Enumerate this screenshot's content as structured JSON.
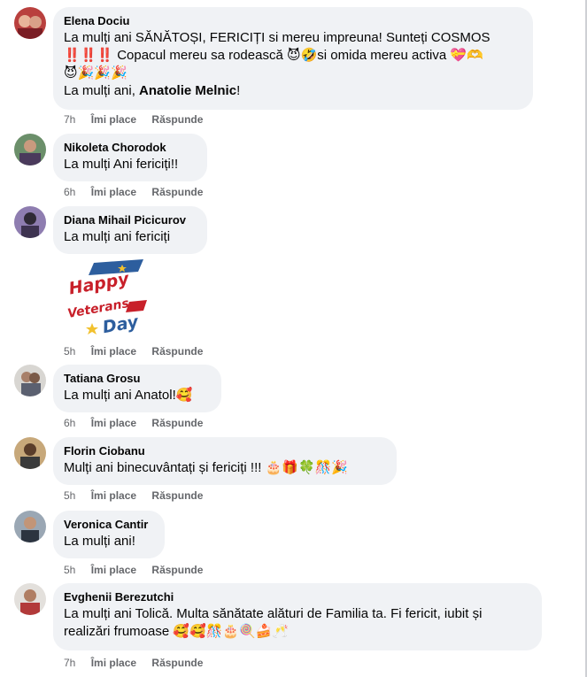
{
  "comments": [
    {
      "author": "Elena Dociu",
      "line1": "La mulți ani SĂNĂTOȘI, FERICIȚI si mereu impreuna! Sunteți COSMOS",
      "line2_prefix": "‼️‼️‼️ Copacul mereu sa rodească 😈🤣si omida mereu activa 💝🫶",
      "line3": "😈🎉🎉🎉",
      "line4_prefix": "La mulți ani, ",
      "mention": "Anatolie Melnic",
      "line4_suffix": "!",
      "time": "7h",
      "like": "Îmi place",
      "reply": "Răspunde"
    },
    {
      "author": "Nikoleta Chorodok",
      "text": "La mulți Ani fericiți!!",
      "time": "6h",
      "like": "Îmi place",
      "reply": "Răspunde"
    },
    {
      "author": "Diana Mihail Picicurov",
      "text": "La mulți ani fericiți",
      "time": "5h",
      "like": "Îmi place",
      "reply": "Răspunde",
      "sticker": {
        "word1": "Happy",
        "word2": "Veterans",
        "word3": "Day"
      }
    },
    {
      "author": "Tatiana Grosu",
      "text": "La mulți ani Anatol!🥰",
      "time": "6h",
      "like": "Îmi place",
      "reply": "Răspunde"
    },
    {
      "author": "Florin Ciobanu",
      "text": "Mulți ani binecuvântați și fericiți !!! 🎂🎁🍀🎊🎉",
      "time": "5h",
      "like": "Îmi place",
      "reply": "Răspunde"
    },
    {
      "author": "Veronica Cantir",
      "text": "La mulți ani!",
      "time": "5h",
      "like": "Îmi place",
      "reply": "Răspunde"
    },
    {
      "author": "Evghenii Berezutchi",
      "line1": "La mulți ani Tolică. Multa sănătate alături de Familia ta. Fi fericit, iubit și",
      "line2": "realizări frumoase 🥰🥰🎊🎂🍭🍰🥂",
      "time": "7h",
      "like": "Îmi place",
      "reply": "Răspunde"
    }
  ],
  "colors": {
    "bubble": "#f0f2f5",
    "meta": "#65676b",
    "text": "#050505"
  }
}
